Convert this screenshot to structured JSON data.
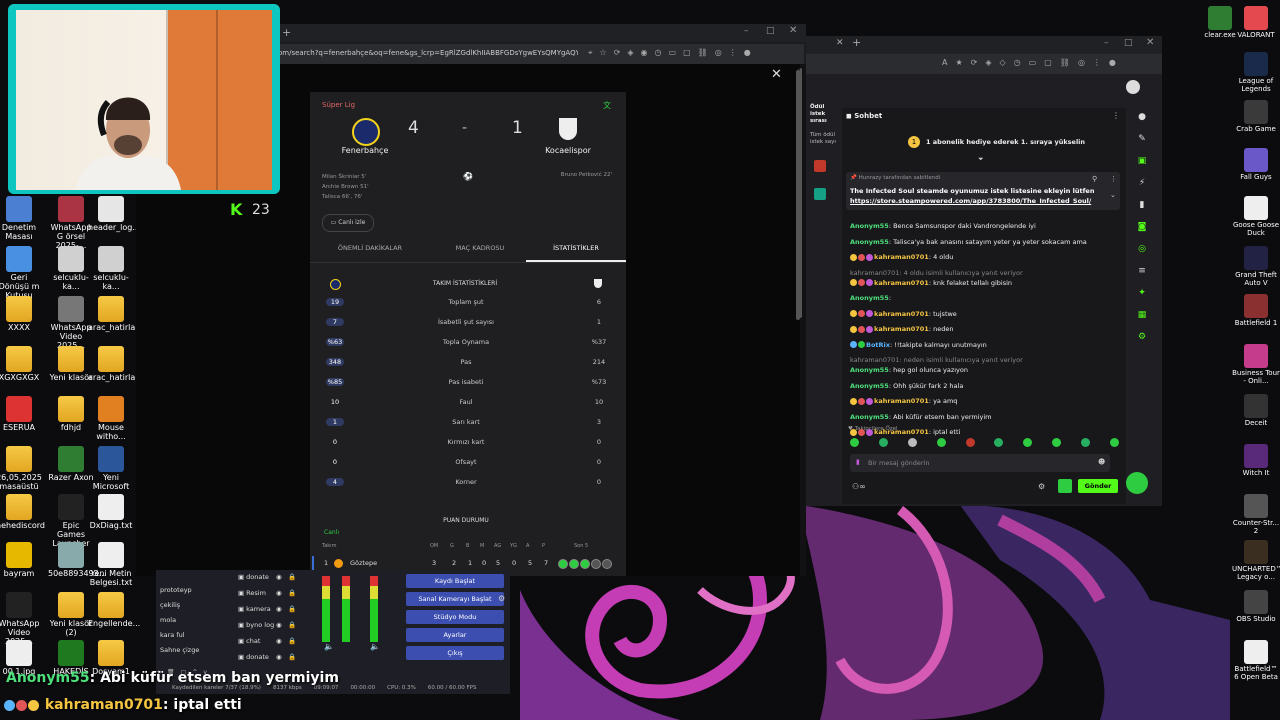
{
  "kick_count": "23",
  "desktop_left": [
    {
      "label": "Denetim Masası"
    },
    {
      "label": "WhatsApp G örsel 2025-..."
    },
    {
      "label": "header_log..."
    },
    {
      "label": "Geri Dönüşü m Kutusu"
    },
    {
      "label": "selcuklu-ka..."
    },
    {
      "label": "selcuklu-ka..."
    },
    {
      "label": "XXXX"
    },
    {
      "label": "WhatsApp Video 2025..."
    },
    {
      "label": "arac_hatirla..."
    },
    {
      "label": "XGXGXGX"
    },
    {
      "label": "Yeni klasör"
    },
    {
      "label": "arac_hatirla..."
    },
    {
      "label": "ESERUA"
    },
    {
      "label": "fdhjd"
    },
    {
      "label": "Mouse witho..."
    },
    {
      "label": "26,05,2025 masaüstü"
    },
    {
      "label": "Razer Axon"
    },
    {
      "label": "Yeni Microsoft ..."
    },
    {
      "label": "hehediscord"
    },
    {
      "label": "Epic Games Launcher"
    },
    {
      "label": "DxDiag.txt"
    },
    {
      "label": "bayram"
    },
    {
      "label": "50e8893493..."
    },
    {
      "label": "Yeni Metin Belgesi.txt"
    },
    {
      "label": "WhatsApp Video 2025..."
    },
    {
      "label": "Yeni klasör (2)"
    },
    {
      "label": "Engellende..."
    },
    {
      "label": "00.1.jpg"
    },
    {
      "label": "HAKEDİŞ"
    },
    {
      "label": "Dosyam1"
    }
  ],
  "desktop_right": [
    {
      "label": "clear.exe"
    },
    {
      "label": "VALORANT"
    },
    {
      "label": "League of Legends"
    },
    {
      "label": "Crab Game"
    },
    {
      "label": "Fall Guys"
    },
    {
      "label": "Goose Goose Duck"
    },
    {
      "label": "Grand Theft Auto V"
    },
    {
      "label": "Battlefield 1"
    },
    {
      "label": "Business Tour - Onli..."
    },
    {
      "label": "Deceit"
    },
    {
      "label": "Witch It"
    },
    {
      "label": "Counter-Str... 2"
    },
    {
      "label": "UNCHARTED™ Legacy o..."
    },
    {
      "label": "OBS Studio"
    },
    {
      "label": "Battlefield™ 6 Open Beta"
    }
  ],
  "browser1": {
    "url": "om/search?q=fenerbahçe&oq=fene&gs_lcrp=EgRlZGdlKhIIABBFGDsYgwEYsQMYgAQY-QcyEggA..."
  },
  "match": {
    "league": "Süper Lig",
    "home_team": "Fenerbahçe",
    "away_team": "Kocaelispor",
    "home_score": "4",
    "separator": "-",
    "away_score": "1",
    "home_scorers": [
      "Milan Škriniar 5'",
      "Archie Brown 51'",
      "Talisca 66', 76'"
    ],
    "away_scorers": [
      "Bruno Petković 22'"
    ],
    "live_label": "Canlı izle",
    "tabs": [
      "ÖNEMLİ DAKİKALAR",
      "MAÇ KADROSU",
      "İSTATİSTİKLER"
    ],
    "stats_title": "TAKIM İSTATİSTİKLERİ",
    "stats": [
      {
        "home": "19",
        "label": "Toplam şut",
        "away": "6",
        "hi": true
      },
      {
        "home": "7",
        "label": "İsabetli şut sayısı",
        "away": "1",
        "hi": true
      },
      {
        "home": "%63",
        "label": "Topla Oynama",
        "away": "%37",
        "hi": true
      },
      {
        "home": "348",
        "label": "Pas",
        "away": "214",
        "hi": true
      },
      {
        "home": "%85",
        "label": "Pas isabeti",
        "away": "%73",
        "hi": true
      },
      {
        "home": "10",
        "label": "Faul",
        "away": "10",
        "hi": false
      },
      {
        "home": "1",
        "label": "Sarı kart",
        "away": "3",
        "hi": true
      },
      {
        "home": "0",
        "label": "Kırmızı kart",
        "away": "0",
        "hi": false
      },
      {
        "home": "0",
        "label": "Ofsayt",
        "away": "0",
        "hi": false
      },
      {
        "home": "4",
        "label": "Korner",
        "away": "0",
        "hi": true
      }
    ],
    "standings_title": "PUAN DURUMU",
    "standings_live": "Canlı",
    "standings_headers": [
      "Takım",
      "OM",
      "G",
      "B",
      "M",
      "AG",
      "YG",
      "A",
      "P",
      "Son 5"
    ],
    "standings_row": {
      "pos": "1",
      "team": "Göztepe",
      "om": "3",
      "g": "2",
      "b": "1",
      "m": "0",
      "ag": "5",
      "yg": "0",
      "a": "5",
      "p": "7"
    }
  },
  "chat": {
    "title": "Sohbet",
    "sidebar_label_1": "Ödül istek sırası",
    "sidebar_label_2": "Tüm ödül istek sayı",
    "gift_banner": "1 abonelik hediye ederek 1. sıraya yükselin",
    "pinned_by": "Hunrazy tarafından sabitlendi",
    "pinned_text": "The Infected Soul steamde oyunumuz istek listesine ekleyin lütfen",
    "pinned_link": "https://store.steampowered.com/app/3783800/The_Infected_Soul/",
    "messages": [
      {
        "user": "Anonym55",
        "color": "green",
        "text": "Bence Samsunspor daki Vandrongelende iyi",
        "reply": ""
      },
      {
        "user": "Anonym55",
        "color": "green",
        "text": "Talisca'ya bak anasını satayım yeter ya yeter sokacam ama",
        "reply": ""
      },
      {
        "user": "kahraman0701",
        "color": "yellow",
        "text": "4 oldu",
        "reply": ""
      },
      {
        "user": "kahraman0701",
        "color": "yellow",
        "text": "knk felaket tellalı gibisin",
        "reply": "kahraman0701: 4 oldu isimli kullanıcıya yanıt veriyor"
      },
      {
        "user": "Anonym55",
        "color": "green",
        "text": "",
        "reply": ""
      },
      {
        "user": "kahraman0701",
        "color": "yellow",
        "text": "tujstwe",
        "reply": ""
      },
      {
        "user": "kahraman0701",
        "color": "yellow",
        "text": "neden",
        "reply": ""
      },
      {
        "user": "BotRix",
        "color": "blue",
        "text": "!!takipte kalmayı unutmayın",
        "reply": ""
      },
      {
        "user": "Anonym55",
        "color": "green",
        "text": "hep gol olunca yazıyon",
        "reply": "kahraman0701: neden isimli kullanıcıya yanıt veriyor"
      },
      {
        "user": "Anonym55",
        "color": "green",
        "text": "Ohh şükür fark 2 hala",
        "reply": ""
      },
      {
        "user": "kahraman0701",
        "color": "yellow",
        "text": "ya amq",
        "reply": ""
      },
      {
        "user": "Anonym55",
        "color": "green",
        "text": "Abi küfür etsem ban yermiyim",
        "reply": ""
      },
      {
        "user": "kahraman0701",
        "color": "yellow",
        "text": "iptal etti",
        "reply": ""
      }
    ],
    "followers_label": "Takipçilere Özel",
    "input_placeholder": "Bir mesaj gönderin",
    "send_label": "Gönder"
  },
  "obs": {
    "scenes": [
      "prototeyp",
      "çekiliş",
      "mola",
      "kara ful",
      "Sahne çizge"
    ],
    "sources": [
      "donate",
      "Resim",
      "kamera",
      "byno log",
      "chat",
      "donate"
    ],
    "buttons": [
      "Kaydı Başlat",
      "Sanal Kamerayı Başlat",
      "Stüdyo Modu",
      "Ayarlar",
      "Çıkış"
    ],
    "status_dropped": "Kaydedilen kareler 7/37 (18.9%)",
    "status_kbps": "8137 kbps",
    "status_time1": "09:09:07",
    "status_time2": "00:00:00",
    "status_cpu": "CPU: 0.3%",
    "status_fps": "60.00 / 60.00 FPS"
  },
  "overlay": {
    "line1_user": "Anonym55",
    "line1_text": ": Abi küfür etsem ban yermiyim",
    "line2_user": "kahraman0701",
    "line2_text": ": iptal etti"
  }
}
